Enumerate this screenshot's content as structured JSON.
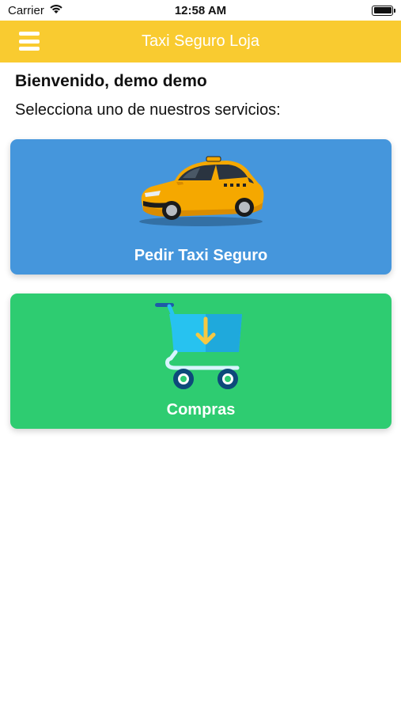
{
  "status_bar": {
    "carrier": "Carrier",
    "time": "12:58 AM"
  },
  "navbar": {
    "title": "Taxi Seguro Loja",
    "background": "#f9cb30",
    "menu_icon": "hamburger-menu-icon"
  },
  "main": {
    "welcome": "Bienvenido, demo demo",
    "prompt": "Selecciona uno de nuestros servicios:"
  },
  "services": [
    {
      "label": "Pedir Taxi Seguro",
      "color": "#4596dc",
      "icon": "taxi-car-image"
    },
    {
      "label": "Compras",
      "color": "#2ecc71",
      "icon": "shopping-cart-icon"
    }
  ]
}
